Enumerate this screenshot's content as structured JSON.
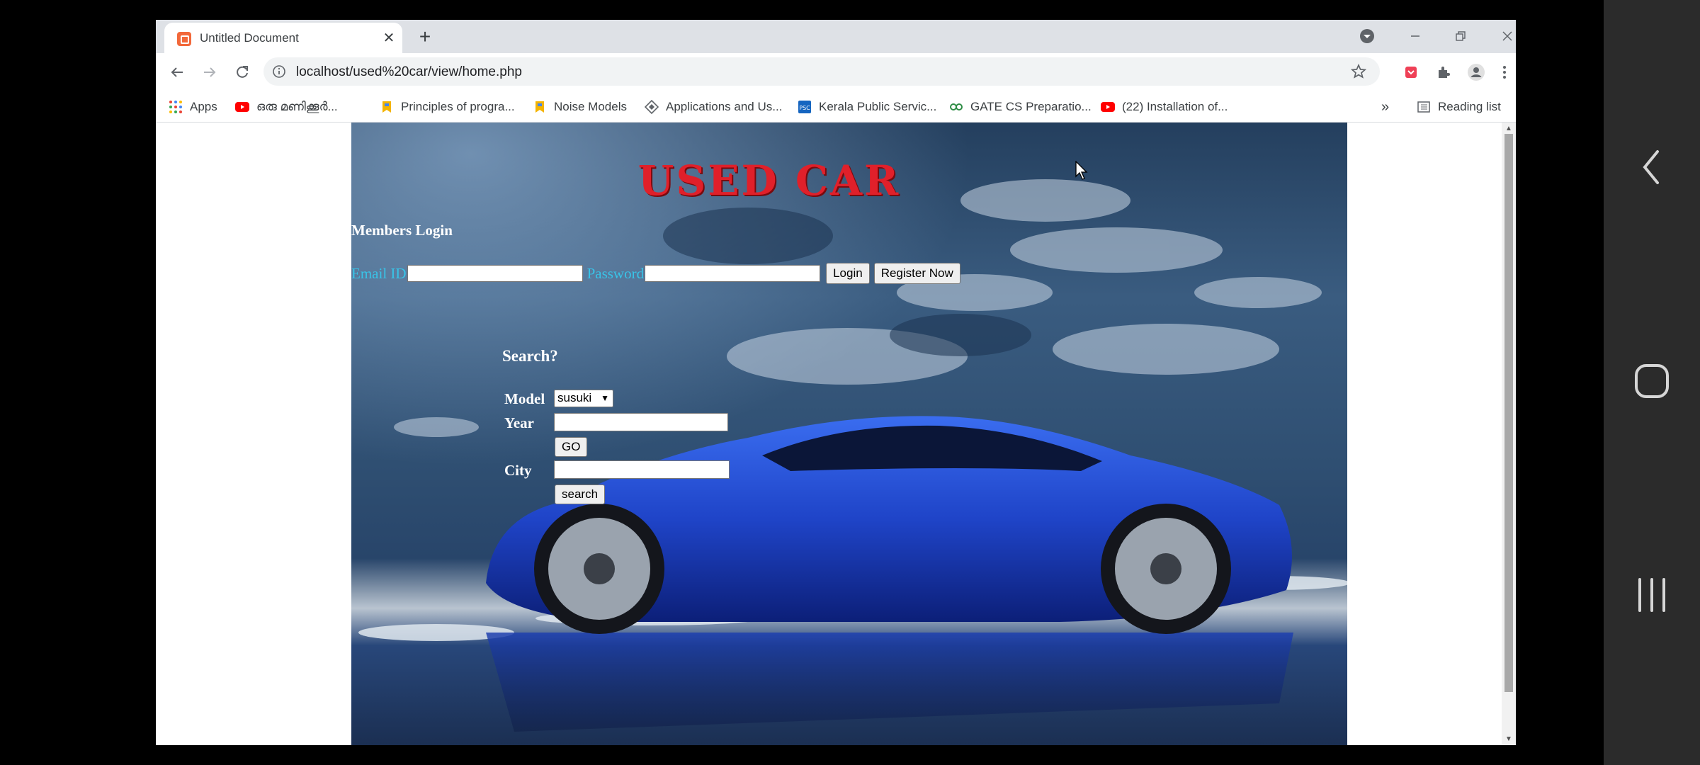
{
  "browser": {
    "tab_title": "Untitled Document",
    "url": "localhost/used%20car/view/home.php"
  },
  "bookmarks": [
    {
      "label": "Apps",
      "icon": "apps-grid-icon"
    },
    {
      "label": "ഒരു മണിക്കൂർ...",
      "icon": "youtube-icon"
    },
    {
      "label": "Principles of progra...",
      "icon": "bookmark-site-icon"
    },
    {
      "label": "Noise Models",
      "icon": "bookmark-site-icon"
    },
    {
      "label": "Applications and Us...",
      "icon": "diamond-site-icon"
    },
    {
      "label": "Kerala Public Servic...",
      "icon": "psc-icon"
    },
    {
      "label": "GATE CS Preparatio...",
      "icon": "gfg-icon"
    },
    {
      "label": "(22) Installation of...",
      "icon": "youtube-icon"
    }
  ],
  "reading_list": "Reading list",
  "page": {
    "site_title": "USED CAR",
    "members_login": "Members Login",
    "email_label": "Email ID",
    "password_label": "Password",
    "login_button": "Login",
    "register_button": "Register Now",
    "search_heading": "Search?",
    "model_label": "Model",
    "model_selected": "susuki",
    "year_label": "Year",
    "go_button": "GO",
    "city_label": "City",
    "search_button": "search"
  },
  "colors": {
    "title_red": "#e0202a",
    "label_cyan": "#38c4e8"
  }
}
